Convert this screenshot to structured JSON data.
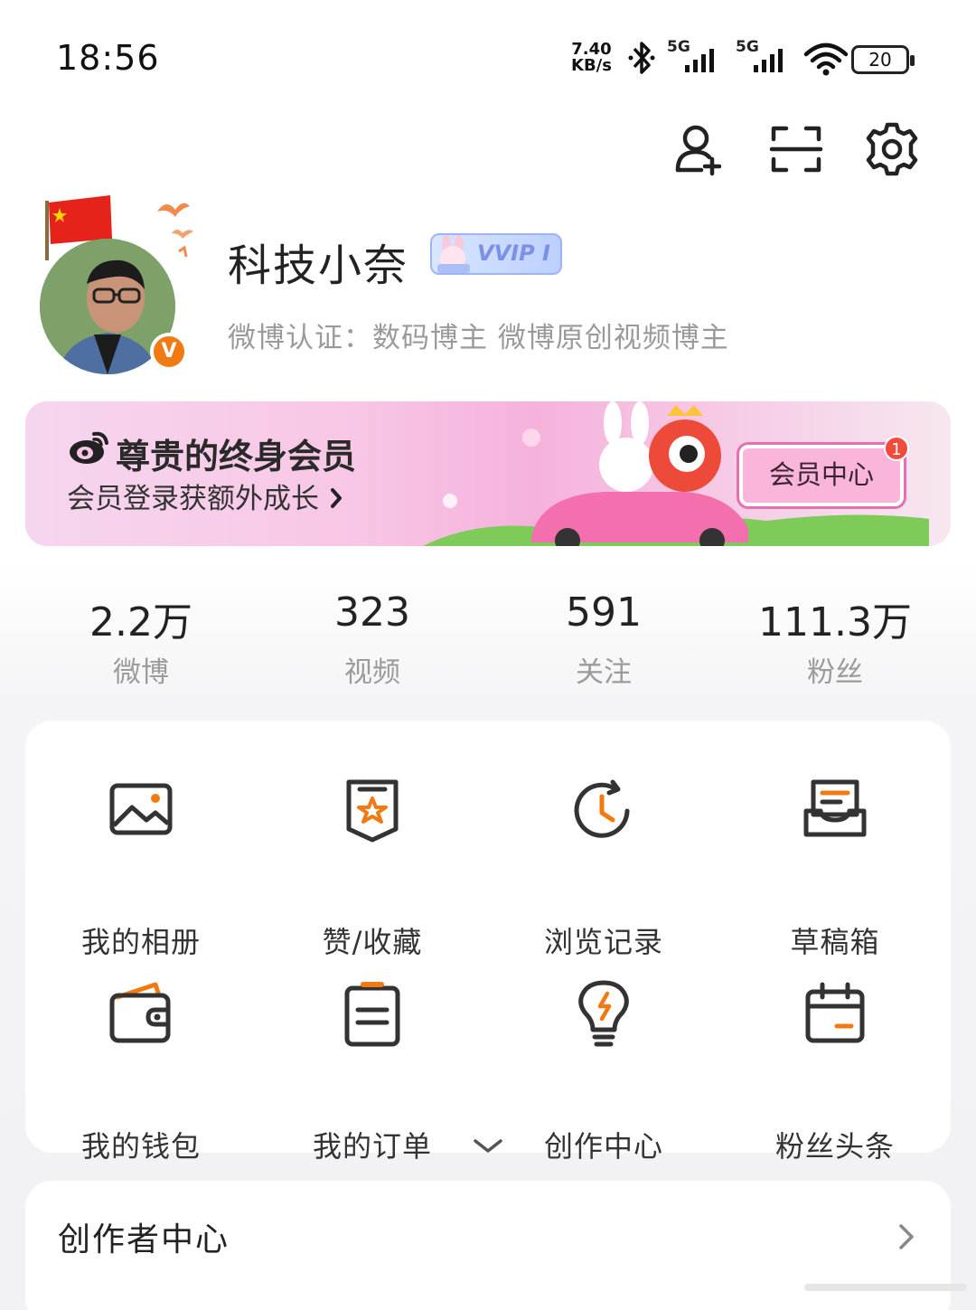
{
  "status_bar": {
    "time": "18:56",
    "net_speed_value": "7.40",
    "net_speed_unit": "KB/s",
    "signal1_label": "5G",
    "signal2_label": "5G",
    "battery": "20"
  },
  "toolbar": {
    "icons": [
      "add-friend-icon",
      "scan-icon",
      "settings-icon"
    ]
  },
  "profile": {
    "name": "科技小奈",
    "badge": "VVIP I",
    "verify_badge": "V",
    "verification": "微博认证：数码博主 微博原创视频博主"
  },
  "vip_banner": {
    "title": "尊贵的终身会员",
    "subtitle": "会员登录获额外成长",
    "button": "会员中心",
    "notification_count": "1",
    "colors": {
      "accent": "#e56fb1",
      "button_bg": "#f9b5da"
    }
  },
  "stats": [
    {
      "value": "2.2万",
      "label": "微博"
    },
    {
      "value": "323",
      "label": "视频"
    },
    {
      "value": "591",
      "label": "关注"
    },
    {
      "value": "111.3万",
      "label": "粉丝"
    }
  ],
  "shortcuts": [
    {
      "label": "我的相册",
      "icon": "album-icon"
    },
    {
      "label": "赞/收藏",
      "icon": "favorites-icon"
    },
    {
      "label": "浏览记录",
      "icon": "history-icon"
    },
    {
      "label": "草稿箱",
      "icon": "drafts-icon"
    },
    {
      "label": "我的钱包",
      "icon": "wallet-icon"
    },
    {
      "label": "我的订单",
      "icon": "orders-icon"
    },
    {
      "label": "创作中心",
      "icon": "creation-center-icon"
    },
    {
      "label": "粉丝头条",
      "icon": "fan-headline-icon"
    }
  ],
  "creator_section": {
    "title": "创作者中心"
  },
  "colors": {
    "accent_orange": "#f27a12",
    "icon_dark": "#333333"
  }
}
